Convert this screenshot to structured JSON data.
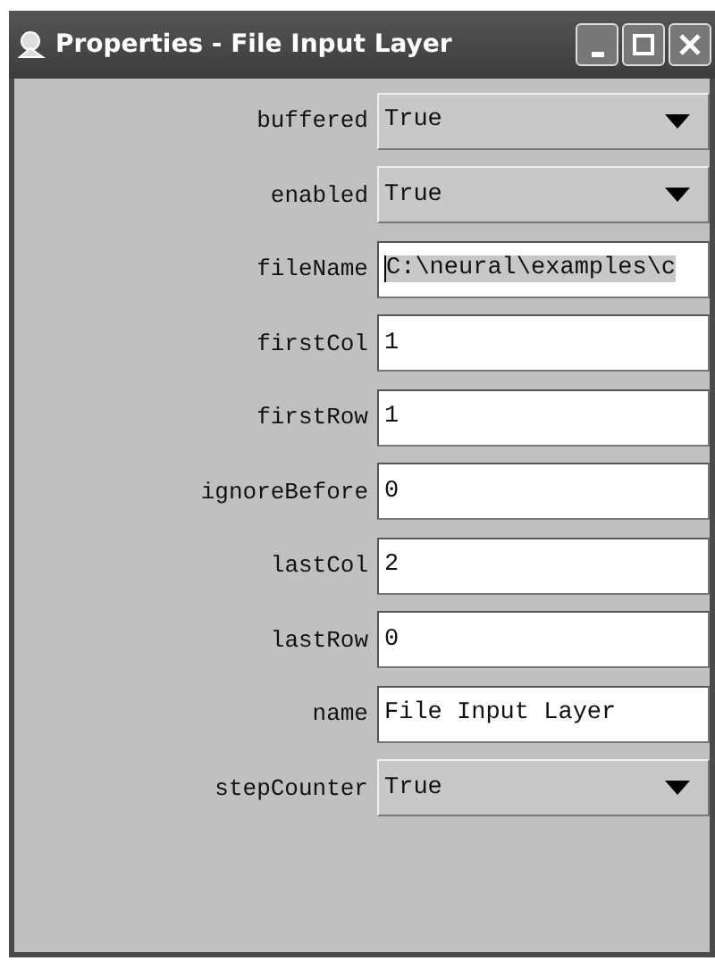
{
  "window": {
    "title": "Properties - File Input Layer"
  },
  "properties": [
    {
      "label": "buffered",
      "kind": "dropdown",
      "value": "True"
    },
    {
      "label": "enabled",
      "kind": "dropdown",
      "value": "True"
    },
    {
      "label": "fileName",
      "kind": "text",
      "value": "C:\\neural\\examples\\c",
      "focused": true
    },
    {
      "label": "firstCol",
      "kind": "text",
      "value": "1",
      "focused": false
    },
    {
      "label": "firstRow",
      "kind": "text",
      "value": "1",
      "focused": false
    },
    {
      "label": "ignoreBefore",
      "kind": "text",
      "value": "0",
      "focused": false
    },
    {
      "label": "lastCol",
      "kind": "text",
      "value": "2",
      "focused": false
    },
    {
      "label": "lastRow",
      "kind": "text",
      "value": "0",
      "focused": false
    },
    {
      "label": "name",
      "kind": "text",
      "value": "File Input Layer",
      "focused": false
    },
    {
      "label": "stepCounter",
      "kind": "dropdown",
      "value": "True"
    }
  ]
}
